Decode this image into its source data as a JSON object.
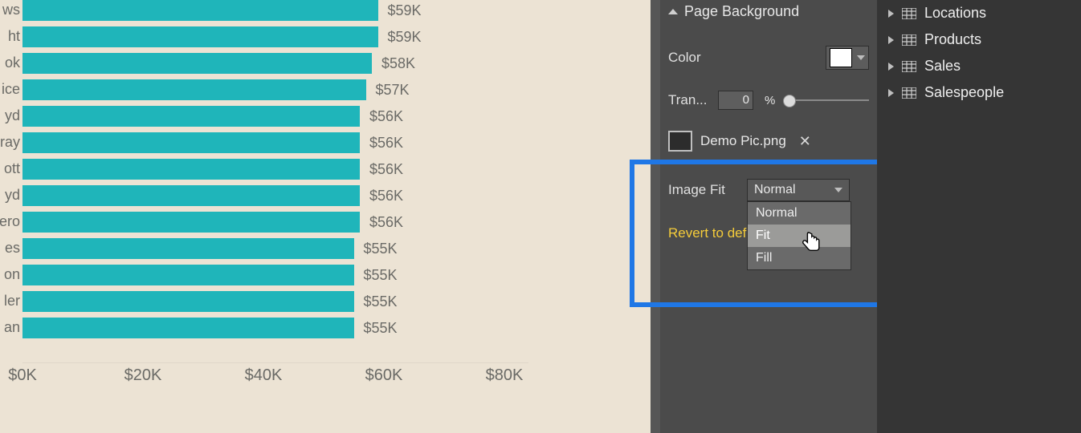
{
  "chart_data": {
    "type": "bar",
    "orientation": "horizontal",
    "xlabel": "",
    "ylabel": "",
    "xlim": [
      0,
      80
    ],
    "ticks": [
      "$0K",
      "$20K",
      "$40K",
      "$60K",
      "$80K"
    ],
    "bars": [
      {
        "category": "ws",
        "value": 59,
        "label": "$59K"
      },
      {
        "category": "ht",
        "value": 59,
        "label": "$59K"
      },
      {
        "category": "ok",
        "value": 58,
        "label": "$58K"
      },
      {
        "category": "ice",
        "value": 57,
        "label": "$57K"
      },
      {
        "category": "yd",
        "value": 56,
        "label": "$56K"
      },
      {
        "category": "ray",
        "value": 56,
        "label": "$56K"
      },
      {
        "category": "ott",
        "value": 56,
        "label": "$56K"
      },
      {
        "category": "yd",
        "value": 56,
        "label": "$56K"
      },
      {
        "category": "ero",
        "value": 56,
        "label": "$56K"
      },
      {
        "category": "es",
        "value": 55,
        "label": "$55K"
      },
      {
        "category": "on",
        "value": 55,
        "label": "$55K"
      },
      {
        "category": "ler",
        "value": 55,
        "label": "$55K"
      },
      {
        "category": "an",
        "value": 55,
        "label": "$55K"
      }
    ],
    "bar_color": "#1fb5ba"
  },
  "format_panel": {
    "section_title": "Page Background",
    "color_label": "Color",
    "color_value": "#ffffff",
    "transparency_label": "Tran...",
    "transparency_value": "0",
    "transparency_unit": "%",
    "image_name": "Demo Pic.png",
    "image_fit_label": "Image Fit",
    "image_fit_selected": "Normal",
    "image_fit_options": [
      "Normal",
      "Fit",
      "Fill"
    ],
    "revert_text": "Revert to def"
  },
  "fields_panel": {
    "items": [
      "Locations",
      "Products",
      "Sales",
      "Salespeople"
    ]
  }
}
